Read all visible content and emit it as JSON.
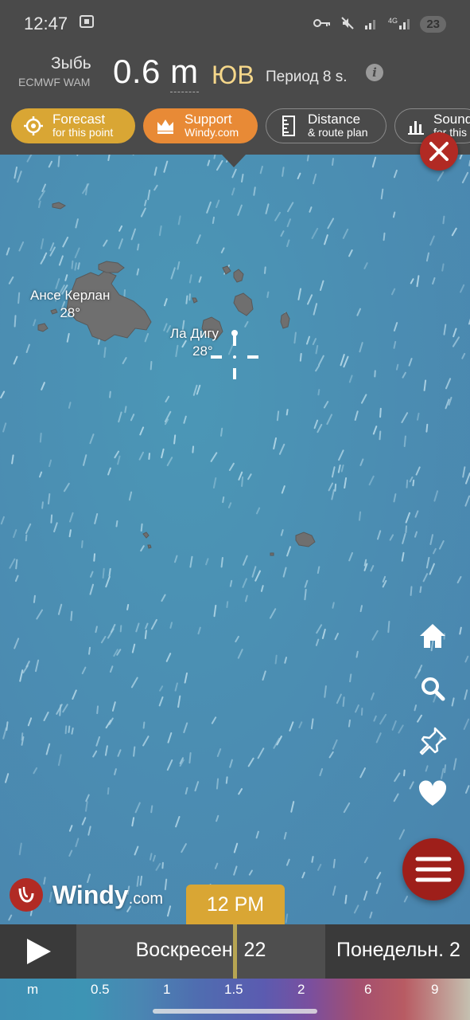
{
  "status_bar": {
    "time": "12:47",
    "battery": "23"
  },
  "header": {
    "layer_name": "Зыбь",
    "model": "ECMWF WAM",
    "value": "0.6",
    "unit": "m",
    "direction": "ЮВ",
    "period": "Период 8 s."
  },
  "actions": [
    {
      "l1": "Forecast",
      "l2": "for this point"
    },
    {
      "l1": "Support",
      "l2": "Windy.com"
    },
    {
      "l1": "Distance",
      "l2": "& route plan"
    },
    {
      "l1": "Sound",
      "l2": "for this"
    }
  ],
  "map": {
    "places": [
      {
        "name": "Ансе Керлан",
        "temp": "28°"
      },
      {
        "name": "Ла Дигу",
        "temp": "28°"
      }
    ]
  },
  "brand": {
    "name": "Windy",
    "suffix": ".com"
  },
  "timeline": {
    "time": "12 PM",
    "current_day": "Воскресен. 22",
    "next_day": "Понедельн. 2"
  },
  "scale": {
    "unit": "m",
    "ticks": [
      "0.5",
      "1",
      "1.5",
      "2",
      "6",
      "9"
    ]
  },
  "colors": {
    "accent_gold": "#d9a634",
    "accent_orange": "#e88a36",
    "brand_red": "#b12a24"
  }
}
